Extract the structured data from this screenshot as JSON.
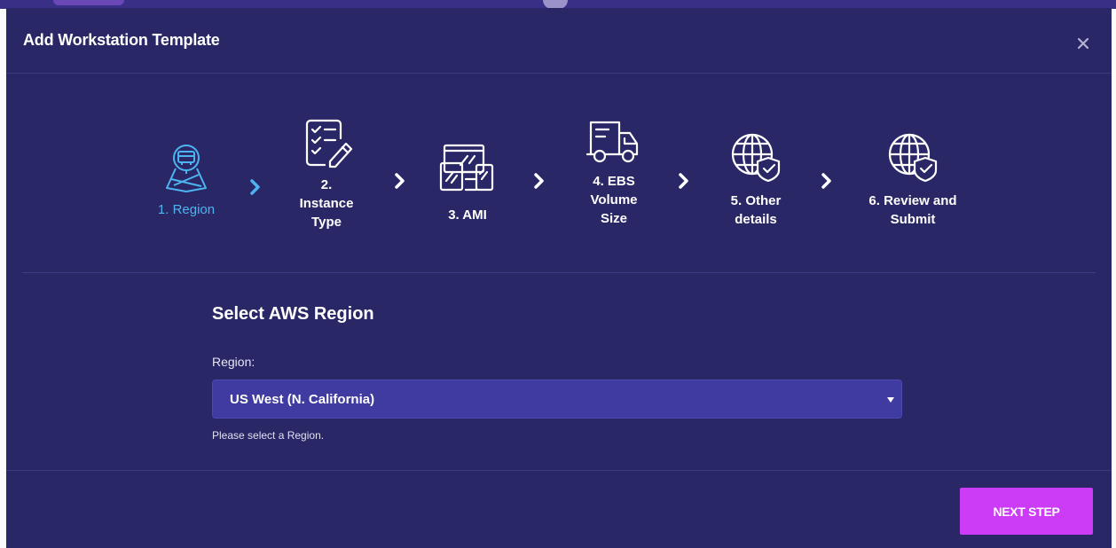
{
  "dialog": {
    "title": "Add Workstation Template",
    "close_icon": "close-icon"
  },
  "steps": [
    {
      "label": "1. Region",
      "icon": "map-bus-icon",
      "active": true
    },
    {
      "label": "2.\nInstance\nType",
      "icon": "checklist-pencil-icon",
      "active": false
    },
    {
      "label": "3. AMI",
      "icon": "devices-icon",
      "active": false
    },
    {
      "label": "4. EBS\nVolume\nSize",
      "icon": "truck-icon",
      "active": false
    },
    {
      "label": "5. Other\ndetails",
      "icon": "globe-shield-icon",
      "active": false
    },
    {
      "label": "6. Review and\nSubmit",
      "icon": "globe-shield-check-icon",
      "active": false
    }
  ],
  "form": {
    "section_title": "Select AWS Region",
    "field_label": "Region:",
    "selected_value": "US West (N. California)",
    "help_text": "Please select a Region."
  },
  "footer": {
    "next_label": "NEXT STEP"
  },
  "colors": {
    "modal_bg": "#2a2766",
    "active_step": "#4db4f0",
    "select_bg": "#3f3ba0",
    "primary_button": "#cc3bf6"
  }
}
